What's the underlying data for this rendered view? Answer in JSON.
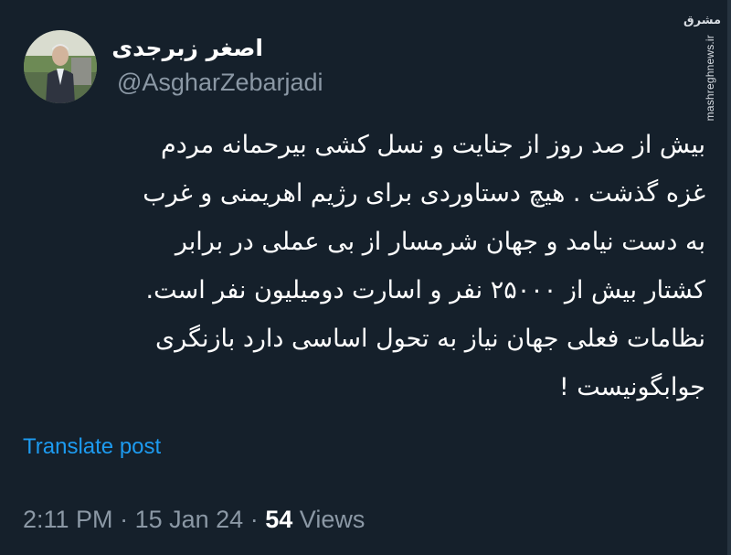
{
  "author": {
    "display_name": "اصغر زبرجدی",
    "handle": "@AsgharZebarjadi"
  },
  "watermark": {
    "logo": "مشرق",
    "site": "mashreghnews.ir"
  },
  "tweet": {
    "lines": [
      "بیش از صد روز از جنایت و نسل کشی بیرحمانه مردم",
      "غزه گذشت . هیچ دستاوردی برای رژیم اهریمنی و غرب",
      "به دست نیامد و جهان شرمسار از بی عملی در برابر",
      "کشتار بیش از ۲۵۰۰۰ نفر و اسارت دومیلیون نفر است.",
      "نظامات فعلی جهان نیاز به تحول اساسی دارد بازنگری",
      "جوابگونیست !"
    ],
    "translate_label": "Translate post"
  },
  "meta": {
    "time": "2:11 PM",
    "separator": "·",
    "date": "15 Jan 24",
    "views_count": "54",
    "views_label": "Views"
  },
  "colors": {
    "background": "#15202b",
    "text": "#ffffff",
    "secondary": "#8b98a5",
    "link": "#1d9bf0"
  }
}
